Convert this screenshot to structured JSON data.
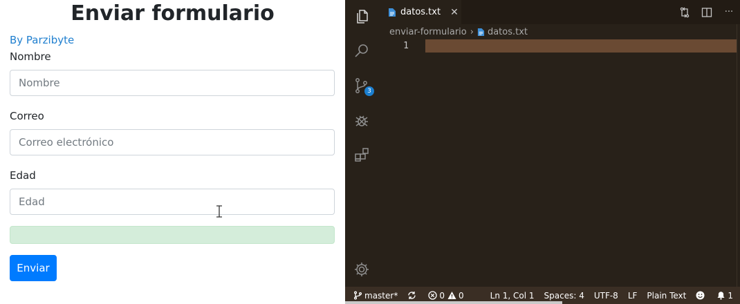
{
  "form": {
    "title": "Enviar formulario",
    "byline": "By Parzibyte",
    "fields": [
      {
        "label": "Nombre",
        "placeholder": "Nombre",
        "value": ""
      },
      {
        "label": "Correo",
        "placeholder": "Correo electrónico",
        "value": ""
      },
      {
        "label": "Edad",
        "placeholder": "Edad",
        "value": ""
      }
    ],
    "submit_label": "Enviar"
  },
  "editor": {
    "activity_bar": {
      "items": [
        "files-icon",
        "search-icon",
        "source-control-icon",
        "debug-icon",
        "extensions-icon"
      ],
      "source_control_badge": "3",
      "bottom": "gear-icon"
    },
    "tab": {
      "label": "datos.txt",
      "close_glyph": "✕"
    },
    "tab_actions": [
      "compare-changes-icon",
      "split-editor-icon",
      "more-icon"
    ],
    "more_glyph": "···",
    "breadcrumb": {
      "folder": "enviar-formulario",
      "separator": "›",
      "file": "datos.txt"
    },
    "lines": [
      "1"
    ],
    "colors": {
      "background": "#282119",
      "current_line": "#6a4a33",
      "statusbar": "#3a2e24",
      "accent": "#1b7fd0"
    }
  },
  "statusbar": {
    "branch": "master*",
    "errors": "0",
    "warnings": "0",
    "position": "Ln 1, Col 1",
    "spaces": "Spaces: 4",
    "encoding": "UTF-8",
    "eol": "LF",
    "language": "Plain Text",
    "notifications": "1"
  }
}
